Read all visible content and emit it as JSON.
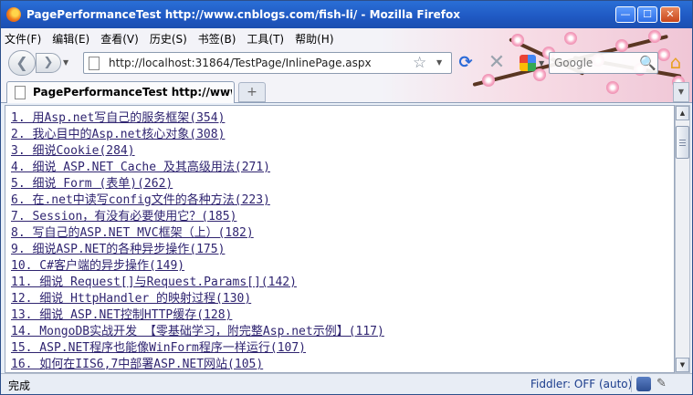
{
  "window": {
    "title": "PagePerformanceTest http://www.cnblogs.com/fish-li/ - Mozilla Firefox",
    "minimize_glyph": "—",
    "maximize_glyph": "☐",
    "close_glyph": "✕"
  },
  "menu": [
    "文件(F)",
    "编辑(E)",
    "查看(V)",
    "历史(S)",
    "书签(B)",
    "工具(T)",
    "帮助(H)"
  ],
  "nav": {
    "back_glyph": "❮",
    "forward_glyph": "❯",
    "url": "http://localhost:31864/TestPage/InlinePage.aspx",
    "bookmark_star": "☆",
    "reload_glyph": "⟳",
    "stop_glyph": "✕",
    "search_placeholder": "Google",
    "search_glyph": "🔍",
    "home_glyph": "⌂"
  },
  "tabs": {
    "active_label": "PagePerformanceTest http://www.c...",
    "new_tab_glyph": "+"
  },
  "links": [
    "1. 用Asp.net写自己的服务框架(354)",
    "2. 我心目中的Asp.net核心对象(308)",
    "3. 细说Cookie(284)",
    "4. 细说 ASP.NET Cache 及其高级用法(271)",
    "5. 细说 Form (表单)(262)",
    "6. 在.net中读写config文件的各种方法(223)",
    "7. Session，有没有必要使用它？(185)",
    "8. 写自己的ASP.NET MVC框架（上）(182)",
    "9. 细说ASP.NET的各种异步操作(175)",
    "10. C#客户端的异步操作(149)",
    "11. 细说 Request[]与Request.Params[](142)",
    "12. 细说 HttpHandler 的映射过程(130)",
    "13. 细说 ASP.NET控制HTTP缓存(128)",
    "14. MongoDB实战开发 【零基础学习，附完整Asp.net示例】(117)",
    "15. ASP.NET程序也能像WinForm程序一样运行(107)",
    "16. 如何在IIS6,7中部署ASP.NET网站(105)"
  ],
  "status": {
    "text": "完成",
    "fiddler": "Fiddler: OFF (auto)"
  },
  "colors": {
    "titlebar": "#1f58c2",
    "link": "#2f2470",
    "fiddler": "#1a3c8c"
  }
}
